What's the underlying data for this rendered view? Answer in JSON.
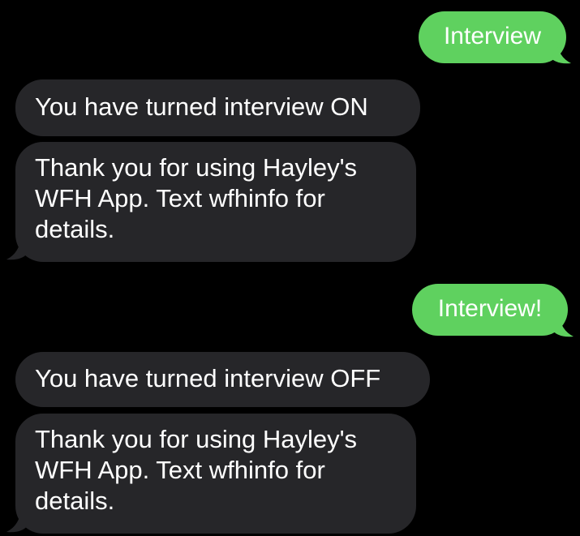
{
  "conversation": {
    "colors": {
      "sent_bubble": "#5fd15f",
      "received_bubble": "#262629",
      "background": "#000000",
      "text": "#ffffff"
    },
    "messages": [
      {
        "direction": "sent",
        "text": "Interview"
      },
      {
        "direction": "received",
        "text": "You have turned interview ON"
      },
      {
        "direction": "received",
        "text": "Thank you for using Hayley's WFH App. Text wfhinfo for details."
      },
      {
        "direction": "sent",
        "text": "Interview!"
      },
      {
        "direction": "received",
        "text": "You have turned interview OFF"
      },
      {
        "direction": "received",
        "text": "Thank you for using Hayley's WFH App. Text wfhinfo for details."
      }
    ]
  }
}
